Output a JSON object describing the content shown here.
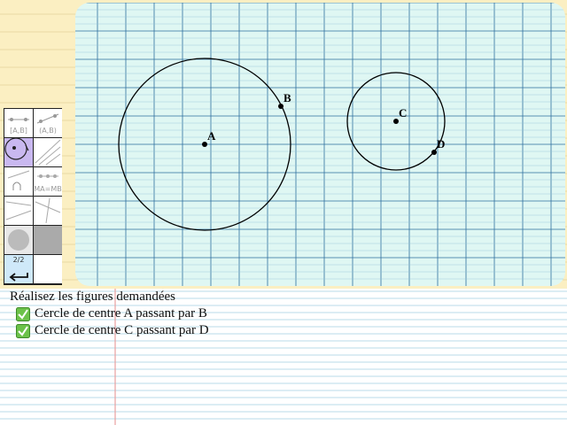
{
  "toolbox": {
    "tools": [
      {
        "name": "tool-segment",
        "label": "[A,B]"
      },
      {
        "name": "tool-segment-copy",
        "label": "(A,B)"
      },
      {
        "name": "tool-compass",
        "label": ""
      },
      {
        "name": "tool-perpendicular",
        "label": ""
      },
      {
        "name": "tool-arc",
        "label": ""
      },
      {
        "name": "tool-equal-length",
        "label": "MA=MB"
      },
      {
        "name": "tool-ruler",
        "label": ""
      },
      {
        "name": "tool-lines",
        "label": ""
      },
      {
        "name": "tool-color",
        "label": ""
      },
      {
        "name": "tool-fill",
        "label": ""
      },
      {
        "name": "tool-page",
        "label": "2/2"
      },
      {
        "name": "tool-blank",
        "label": ""
      }
    ],
    "undo_icon": "undo-arrow-icon"
  },
  "drawing": {
    "points": [
      {
        "label": "A"
      },
      {
        "label": "B"
      },
      {
        "label": "C"
      },
      {
        "label": "D"
      }
    ],
    "colors": {
      "grid_bg": "#dff7f3",
      "grid_line": "#2e6f9e",
      "figure": "#000000"
    }
  },
  "instructions": {
    "title": "Réalisez les figures demandées",
    "tasks": [
      {
        "text": "Cercle de centre A passant par B",
        "done": true
      },
      {
        "text": "Cercle de centre C passant par D",
        "done": true
      }
    ]
  }
}
